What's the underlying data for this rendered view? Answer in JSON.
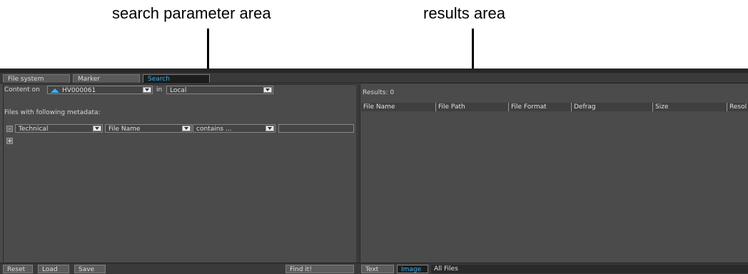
{
  "annotations": {
    "search_area_label": "search parameter area",
    "results_area_label": "results area"
  },
  "tabs": [
    {
      "label": "File system",
      "active": false
    },
    {
      "label": "Marker",
      "active": false
    },
    {
      "label": "Search",
      "active": true
    }
  ],
  "search": {
    "content_on_label": "Content on",
    "content_on_icon": "house-icon",
    "content_on_value": "HV000061",
    "in_label": "in",
    "in_value": "Local",
    "metadata_label": "Files with following metadata:",
    "criteria": {
      "remove_symbol": "-",
      "category": "Technical",
      "field": "File Name",
      "operator": "contains ...",
      "value": ""
    },
    "add_symbol": "+"
  },
  "results": {
    "count_label": "Results: 0",
    "columns": [
      "File Name",
      "File Path",
      "File Format",
      "Defrag",
      "Size",
      "Resol"
    ]
  },
  "bottom_left": {
    "reset": "Reset",
    "load": "Load",
    "save": "Save",
    "find": "Find it!"
  },
  "bottom_right": {
    "text_tab": "Text",
    "image_tab": "Image",
    "filter": "All Files"
  },
  "colors": {
    "accent": "#37b0f0",
    "panel_bg": "#4b4b4b",
    "bar_bg": "#3a3a3a"
  }
}
